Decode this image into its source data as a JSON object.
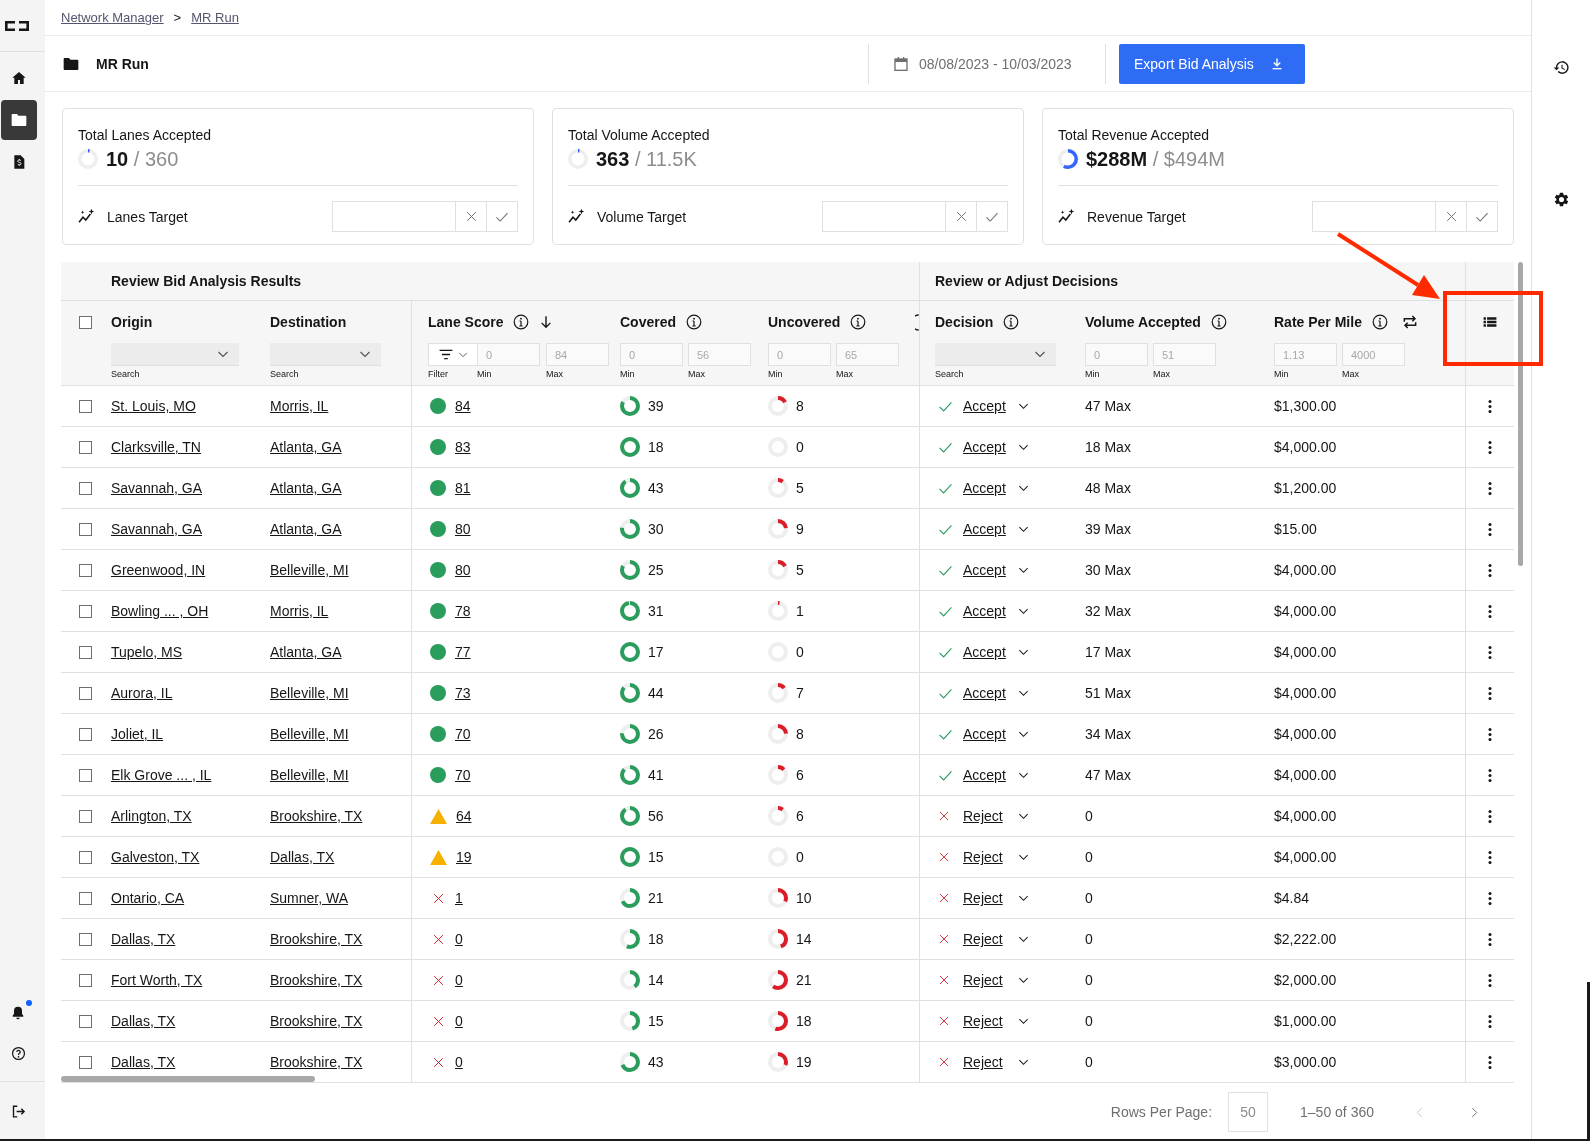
{
  "sidebar": {
    "items": [
      {
        "kind": "home",
        "selected": false
      },
      {
        "kind": "folder",
        "selected": true
      },
      {
        "kind": "invoice",
        "selected": false
      }
    ],
    "bottom_items": [
      {
        "kind": "notifications",
        "unread": true
      },
      {
        "kind": "help"
      },
      {
        "kind": "logout"
      }
    ]
  },
  "breadcrumb": {
    "items": [
      "Network Manager",
      "MR Run"
    ],
    "separator": ">"
  },
  "header": {
    "title": "MR Run",
    "date_range": "08/08/2023 - 10/03/2023",
    "export_button": "Export Bid Analysis"
  },
  "summary_cards": [
    {
      "title": "Total Lanes Accepted",
      "value": "10",
      "total": "/ 360",
      "level": 0.03,
      "target_label": "Lanes Target"
    },
    {
      "title": "Total Volume Accepted",
      "value": "363",
      "total": "/ 11.5K",
      "level": 0.03,
      "target_label": "Volume Target"
    },
    {
      "title": "Total Revenue Accepted",
      "value": "$288M",
      "total": "/ $494M",
      "level": 0.58,
      "target_label": "Revenue Target"
    }
  ],
  "table": {
    "select_all": {
      "checked": false
    },
    "groups": [
      {
        "label": "Review Bid Analysis Results",
        "columns": [
          {
            "kind": "select",
            "label": "Origin",
            "info": false,
            "filter_label": "Search"
          },
          {
            "kind": "select",
            "label": "Destination",
            "info": false,
            "filter_label": "Search"
          },
          {
            "kind": "score",
            "label": "Lane Score",
            "info": true,
            "sort_descending": true,
            "filter_label": "Filter",
            "min_placeholder": "0",
            "max_placeholder": "84",
            "min_label": "Min",
            "max_label": "Max"
          },
          {
            "kind": "range",
            "label": "Covered",
            "info": true,
            "min_placeholder": "0",
            "max_placeholder": "56",
            "min_label": "Min",
            "max_label": "Max"
          },
          {
            "kind": "range",
            "label": "Uncovered",
            "info": true,
            "min_placeholder": "0",
            "max_placeholder": "65",
            "min_label": "Min",
            "max_label": "Max"
          },
          {
            "kind": "clipped",
            "info": true
          }
        ]
      },
      {
        "label": "Review or Adjust Decisions",
        "columns": [
          {
            "kind": "select",
            "label": "Decision",
            "info": true,
            "filter_label": "Search"
          },
          {
            "kind": "range",
            "label": "Volume Accepted",
            "info": true,
            "min_placeholder": "0",
            "max_placeholder": "51",
            "min_label": "Min",
            "max_label": "Max"
          },
          {
            "kind": "range",
            "label": "Rate Per Mile",
            "info": true,
            "swap": true,
            "min_placeholder": "1.13",
            "max_placeholder": "4000",
            "min_label": "Min",
            "max_label": "Max"
          }
        ]
      }
    ],
    "column_settings": {
      "highlighted": true
    },
    "rows": [
      {
        "selected": false,
        "origin": "St. Louis, MO",
        "destination": "Morris, IL",
        "lane_score": {
          "kind": "good",
          "value": "84"
        },
        "covered": {
          "value": "39",
          "level": 0.83
        },
        "uncovered": {
          "value": "8",
          "level": 0.17
        },
        "decision": {
          "kind": "accept",
          "label": "Accept"
        },
        "volume_accepted": "47 Max",
        "rate_per_mile": "$1,300.00"
      },
      {
        "selected": false,
        "origin": "Clarksville, TN",
        "destination": "Atlanta, GA",
        "lane_score": {
          "kind": "good",
          "value": "83"
        },
        "covered": {
          "value": "18",
          "level": 1
        },
        "uncovered": {
          "value": "0",
          "level": 0
        },
        "decision": {
          "kind": "accept",
          "label": "Accept"
        },
        "volume_accepted": "18 Max",
        "rate_per_mile": "$4,000.00"
      },
      {
        "selected": false,
        "origin": "Savannah, GA",
        "destination": "Atlanta, GA",
        "lane_score": {
          "kind": "good",
          "value": "81"
        },
        "covered": {
          "value": "43",
          "level": 0.9
        },
        "uncovered": {
          "value": "5",
          "level": 0.1
        },
        "decision": {
          "kind": "accept",
          "label": "Accept"
        },
        "volume_accepted": "48 Max",
        "rate_per_mile": "$1,200.00"
      },
      {
        "selected": false,
        "origin": "Savannah, GA",
        "destination": "Atlanta, GA",
        "lane_score": {
          "kind": "good",
          "value": "80"
        },
        "covered": {
          "value": "30",
          "level": 0.77
        },
        "uncovered": {
          "value": "9",
          "level": 0.23
        },
        "decision": {
          "kind": "accept",
          "label": "Accept"
        },
        "volume_accepted": "39 Max",
        "rate_per_mile": "$15.00"
      },
      {
        "selected": false,
        "origin": "Greenwood, IN",
        "destination": "Belleville, MI",
        "lane_score": {
          "kind": "good",
          "value": "80"
        },
        "covered": {
          "value": "25",
          "level": 0.83
        },
        "uncovered": {
          "value": "5",
          "level": 0.17
        },
        "decision": {
          "kind": "accept",
          "label": "Accept"
        },
        "volume_accepted": "30 Max",
        "rate_per_mile": "$4,000.00"
      },
      {
        "selected": false,
        "origin": "Bowling ... , OH",
        "destination": "Morris, IL",
        "lane_score": {
          "kind": "good",
          "value": "78"
        },
        "covered": {
          "value": "31",
          "level": 0.97
        },
        "uncovered": {
          "value": "1",
          "level": 0.03
        },
        "decision": {
          "kind": "accept",
          "label": "Accept"
        },
        "volume_accepted": "32 Max",
        "rate_per_mile": "$4,000.00"
      },
      {
        "selected": false,
        "origin": "Tupelo, MS",
        "destination": "Atlanta, GA",
        "lane_score": {
          "kind": "good",
          "value": "77"
        },
        "covered": {
          "value": "17",
          "level": 1
        },
        "uncovered": {
          "value": "0",
          "level": 0
        },
        "decision": {
          "kind": "accept",
          "label": "Accept"
        },
        "volume_accepted": "17 Max",
        "rate_per_mile": "$4,000.00"
      },
      {
        "selected": false,
        "origin": "Aurora, IL",
        "destination": "Belleville, MI",
        "lane_score": {
          "kind": "good",
          "value": "73"
        },
        "covered": {
          "value": "44",
          "level": 0.86
        },
        "uncovered": {
          "value": "7",
          "level": 0.14
        },
        "decision": {
          "kind": "accept",
          "label": "Accept"
        },
        "volume_accepted": "51 Max",
        "rate_per_mile": "$4,000.00"
      },
      {
        "selected": false,
        "origin": "Joliet, IL",
        "destination": "Belleville, MI",
        "lane_score": {
          "kind": "good",
          "value": "70"
        },
        "covered": {
          "value": "26",
          "level": 0.76
        },
        "uncovered": {
          "value": "8",
          "level": 0.24
        },
        "decision": {
          "kind": "accept",
          "label": "Accept"
        },
        "volume_accepted": "34 Max",
        "rate_per_mile": "$4,000.00"
      },
      {
        "selected": false,
        "origin": "Elk Grove ... , IL",
        "destination": "Belleville, MI",
        "lane_score": {
          "kind": "good",
          "value": "70"
        },
        "covered": {
          "value": "41",
          "level": 0.87
        },
        "uncovered": {
          "value": "6",
          "level": 0.13
        },
        "decision": {
          "kind": "accept",
          "label": "Accept"
        },
        "volume_accepted": "47 Max",
        "rate_per_mile": "$4,000.00"
      },
      {
        "selected": false,
        "origin": "Arlington, TX",
        "destination": "Brookshire, TX",
        "lane_score": {
          "kind": "warning",
          "value": "64"
        },
        "covered": {
          "value": "56",
          "level": 0.9
        },
        "uncovered": {
          "value": "6",
          "level": 0.1
        },
        "decision": {
          "kind": "reject",
          "label": "Reject"
        },
        "volume_accepted": "0",
        "rate_per_mile": "$4,000.00"
      },
      {
        "selected": false,
        "origin": "Galveston, TX",
        "destination": "Dallas, TX",
        "lane_score": {
          "kind": "warning",
          "value": "19"
        },
        "covered": {
          "value": "15",
          "level": 1
        },
        "uncovered": {
          "value": "0",
          "level": 0
        },
        "decision": {
          "kind": "reject",
          "label": "Reject"
        },
        "volume_accepted": "0",
        "rate_per_mile": "$4,000.00"
      },
      {
        "selected": false,
        "origin": "Ontario, CA",
        "destination": "Sumner, WA",
        "lane_score": {
          "kind": "fail",
          "value": "1"
        },
        "covered": {
          "value": "21",
          "level": 0.68
        },
        "uncovered": {
          "value": "10",
          "level": 0.32
        },
        "decision": {
          "kind": "reject",
          "label": "Reject"
        },
        "volume_accepted": "0",
        "rate_per_mile": "$4.84"
      },
      {
        "selected": false,
        "origin": "Dallas, TX",
        "destination": "Brookshire, TX",
        "lane_score": {
          "kind": "fail",
          "value": "0"
        },
        "covered": {
          "value": "18",
          "level": 0.56
        },
        "uncovered": {
          "value": "14",
          "level": 0.44
        },
        "decision": {
          "kind": "reject",
          "label": "Reject"
        },
        "volume_accepted": "0",
        "rate_per_mile": "$2,222.00"
      },
      {
        "selected": false,
        "origin": "Fort Worth, TX",
        "destination": "Brookshire, TX",
        "lane_score": {
          "kind": "fail",
          "value": "0"
        },
        "covered": {
          "value": "14",
          "level": 0.4
        },
        "uncovered": {
          "value": "21",
          "level": 0.6
        },
        "decision": {
          "kind": "reject",
          "label": "Reject"
        },
        "volume_accepted": "0",
        "rate_per_mile": "$2,000.00"
      },
      {
        "selected": false,
        "origin": "Dallas, TX",
        "destination": "Brookshire, TX",
        "lane_score": {
          "kind": "fail",
          "value": "0"
        },
        "covered": {
          "value": "15",
          "level": 0.45
        },
        "uncovered": {
          "value": "18",
          "level": 0.55
        },
        "decision": {
          "kind": "reject",
          "label": "Reject"
        },
        "volume_accepted": "0",
        "rate_per_mile": "$1,000.00"
      },
      {
        "selected": false,
        "origin": "Dallas, TX",
        "destination": "Brookshire, TX",
        "lane_score": {
          "kind": "fail",
          "value": "0"
        },
        "covered": {
          "value": "43",
          "level": 0.69
        },
        "uncovered": {
          "value": "19",
          "level": 0.31
        },
        "decision": {
          "kind": "reject",
          "label": "Reject"
        },
        "volume_accepted": "0",
        "rate_per_mile": "$3,000.00"
      }
    ]
  },
  "pagination": {
    "rows_per_page_label": "Rows Per Page:",
    "rows_per_page": "50",
    "range": "1–50 of 360",
    "previous_disabled": true,
    "next_disabled": false
  },
  "right_panel": {
    "items": [
      {
        "kind": "history"
      },
      {
        "kind": "settings"
      }
    ]
  }
}
